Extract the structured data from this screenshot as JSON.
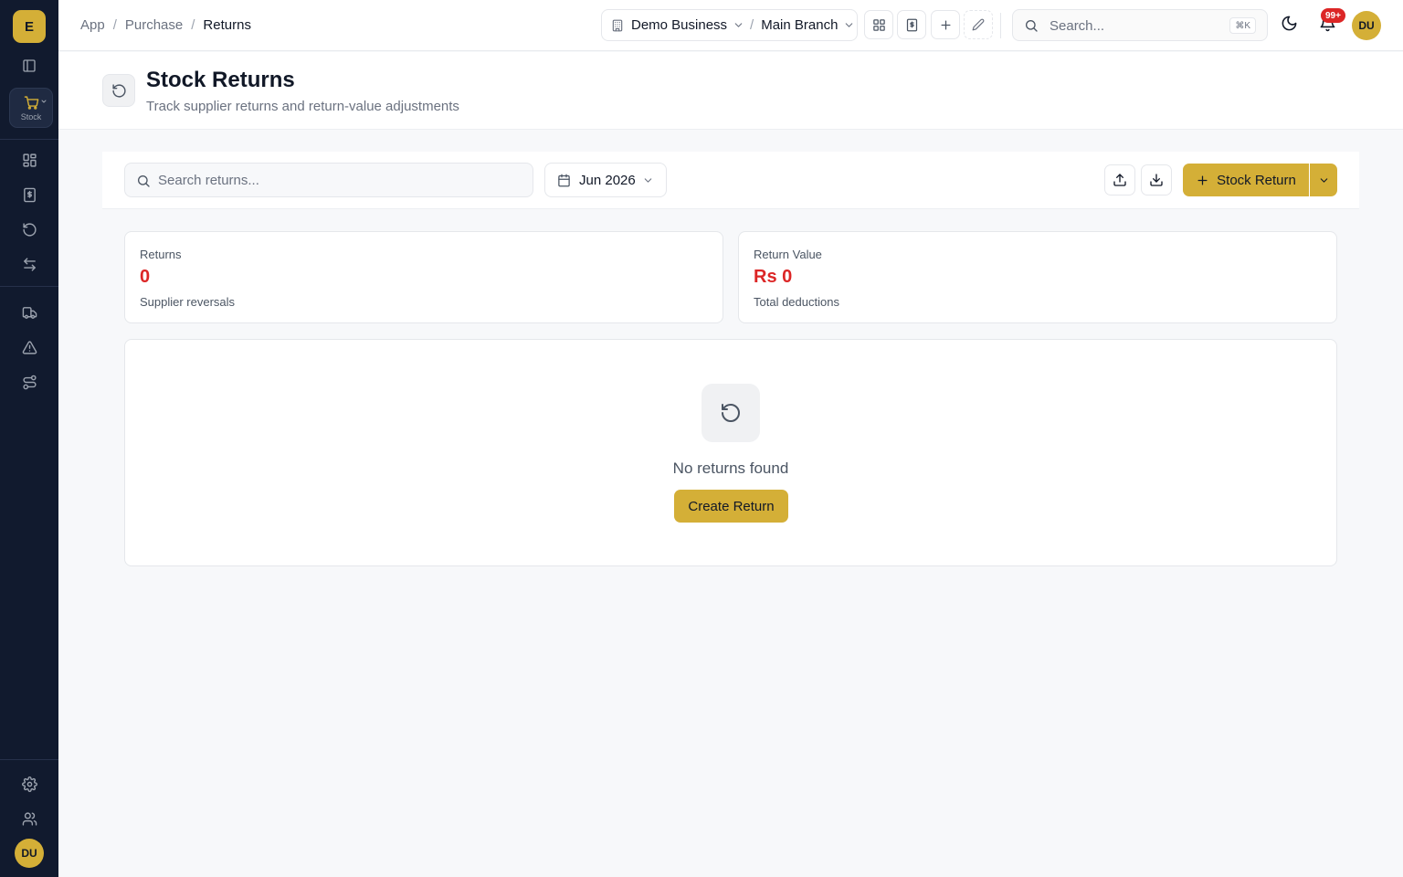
{
  "app": {
    "logo_letter": "E",
    "user_initials": "DU"
  },
  "sidebar": {
    "active_module": {
      "label": "Stock",
      "icon": "cart-icon"
    },
    "items": [
      {
        "name": "toggle",
        "icon": "panel-icon"
      },
      {
        "name": "dashboard",
        "icon": "grid-icon"
      },
      {
        "name": "invoices",
        "icon": "receipt-icon"
      },
      {
        "name": "returns",
        "icon": "rotate-ccw-icon"
      },
      {
        "name": "transfers",
        "icon": "arrows-icon"
      },
      {
        "name": "delivery",
        "icon": "truck-icon"
      },
      {
        "name": "alerts",
        "icon": "alert-triangle-icon"
      },
      {
        "name": "workflow",
        "icon": "route-icon"
      },
      {
        "name": "settings",
        "icon": "gear-icon"
      },
      {
        "name": "users",
        "icon": "users-icon"
      }
    ]
  },
  "breadcrumbs": [
    "App",
    "Purchase",
    "Returns"
  ],
  "breadcrumb_separator": "/",
  "business": {
    "name": "Demo Business",
    "branch": "Main Branch",
    "separator": "/"
  },
  "global_search": {
    "placeholder": "Search...",
    "shortcut": "⌘K"
  },
  "notifications": {
    "badge": "99+"
  },
  "page": {
    "title": "Stock Returns",
    "subtitle": "Track supplier returns and return-value adjustments"
  },
  "toolbar": {
    "search_placeholder": "Search returns...",
    "month": "Jun 2026",
    "primary_label": "Stock Return"
  },
  "stats": [
    {
      "label": "Returns",
      "value": "0",
      "note": "Supplier reversals"
    },
    {
      "label": "Return Value",
      "value": "Rs 0",
      "note": "Total deductions"
    }
  ],
  "empty_state": {
    "message": "No returns found",
    "action_label": "Create Return"
  },
  "colors": {
    "accent": "#d4af37",
    "sidebar_bg": "#111a2e",
    "value_red": "#dc2626",
    "badge_red": "#dc2626"
  }
}
